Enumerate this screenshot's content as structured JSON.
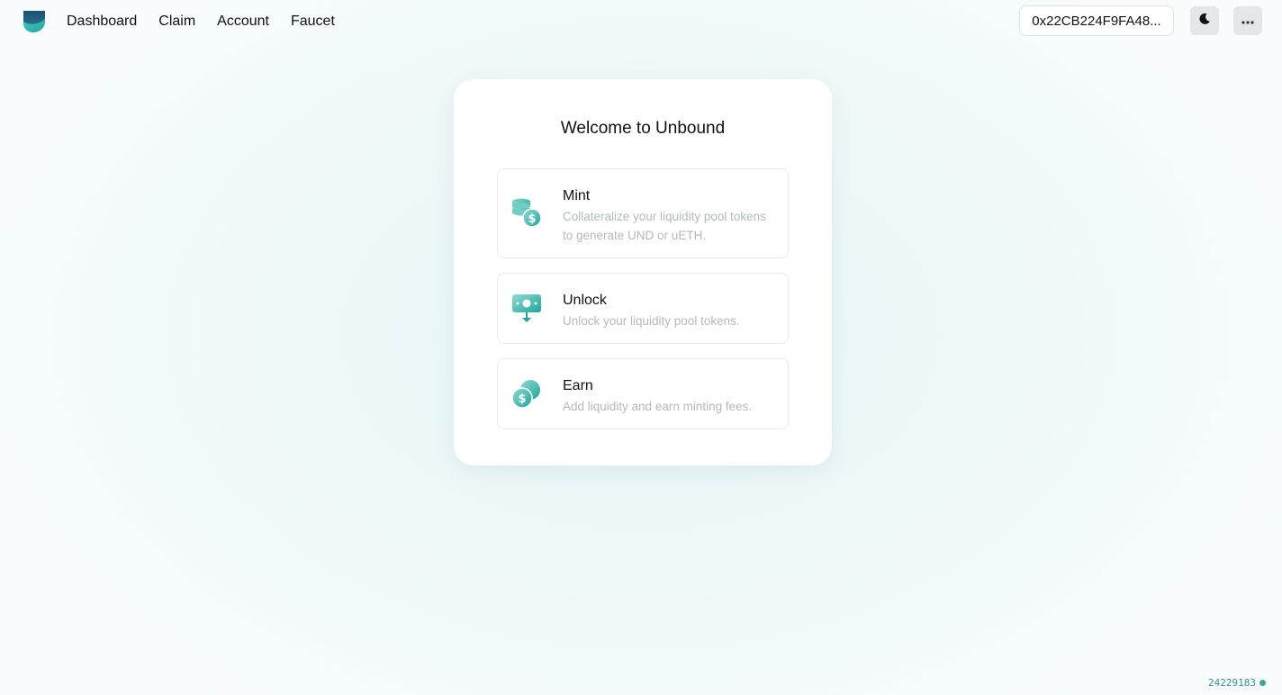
{
  "nav": {
    "items": [
      {
        "label": "Dashboard"
      },
      {
        "label": "Claim"
      },
      {
        "label": "Account"
      },
      {
        "label": "Faucet"
      }
    ]
  },
  "header": {
    "wallet_address": "0x22CB224F9FA48...",
    "theme_icon": "moon-icon",
    "more_icon": "more-horizontal-icon",
    "logo_icon": "unbound-logo"
  },
  "main": {
    "title": "Welcome to Unbound",
    "options": [
      {
        "title": "Mint",
        "description": "Collateralize your liquidity pool tokens to generate UND or uETH.",
        "icon": "coins-dollar-icon"
      },
      {
        "title": "Unlock",
        "description": "Unlock your liquidity pool tokens.",
        "icon": "unlock-cash-icon"
      },
      {
        "title": "Earn",
        "description": "Add liquidity and earn minting fees.",
        "icon": "earn-coins-icon"
      }
    ]
  },
  "footer": {
    "block_number": "24229183"
  },
  "colors": {
    "accent": "#2bb3a6",
    "accent_dark": "#1f8f8c",
    "status_dot": "#3aa89a"
  }
}
